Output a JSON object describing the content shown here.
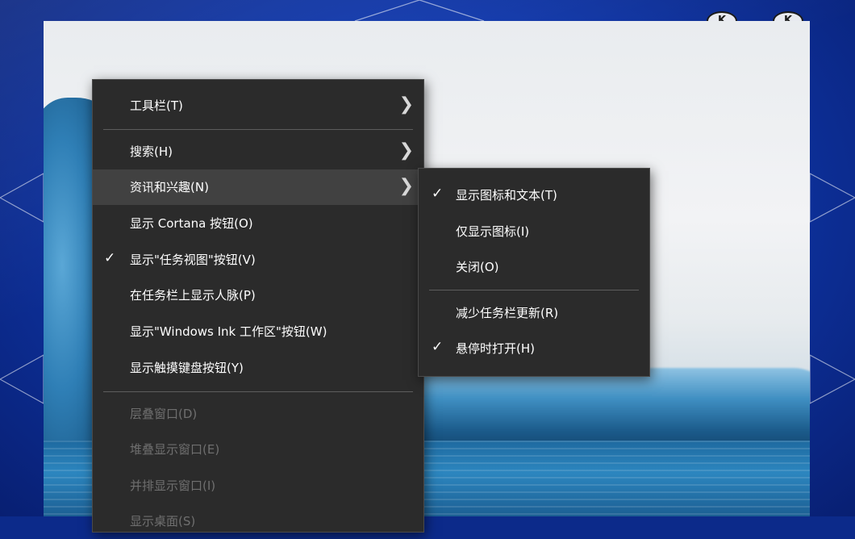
{
  "main_menu": {
    "items": [
      {
        "label": "工具栏(T)",
        "checked": false,
        "submenu": true
      },
      {
        "label": "搜索(H)",
        "checked": false,
        "submenu": true
      },
      {
        "label": "资讯和兴趣(N)",
        "checked": false,
        "submenu": true,
        "highlighted": true
      },
      {
        "label": "显示 Cortana 按钮(O)",
        "checked": false
      },
      {
        "label": "显示\"任务视图\"按钮(V)",
        "checked": true
      },
      {
        "label": "在任务栏上显示人脉(P)",
        "checked": false
      },
      {
        "label": "显示\"Windows Ink 工作区\"按钮(W)",
        "checked": false
      },
      {
        "label": "显示触摸键盘按钮(Y)",
        "checked": false
      },
      {
        "label": "层叠窗口(D)",
        "disabled": true
      },
      {
        "label": "堆叠显示窗口(E)",
        "disabled": true
      },
      {
        "label": "并排显示窗口(I)",
        "disabled": true
      },
      {
        "label": "显示桌面(S)",
        "disabled": true
      }
    ],
    "arrow_icon": "chevron-right-icon",
    "check_icon": "checkmark-icon",
    "check_glyph": "✓",
    "arrow_glyph": "❯"
  },
  "sub_menu": {
    "items": [
      {
        "label": "显示图标和文本(T)",
        "checked": true
      },
      {
        "label": "仅显示图标(I)",
        "checked": false
      },
      {
        "label": "关闭(O)",
        "checked": false
      },
      {
        "label": "减少任务栏更新(R)",
        "checked": false
      },
      {
        "label": "悬停时打开(H)",
        "checked": true
      }
    ]
  },
  "colors": {
    "menu_bg": "#2b2b2b",
    "menu_highlight": "#414141",
    "menu_text": "#ffffff",
    "disabled_text": "#6f6f6f",
    "separator": "#5d5d5d",
    "desktop_bg": "#0f36a8"
  },
  "logos": {
    "left": "K",
    "right": "K"
  }
}
